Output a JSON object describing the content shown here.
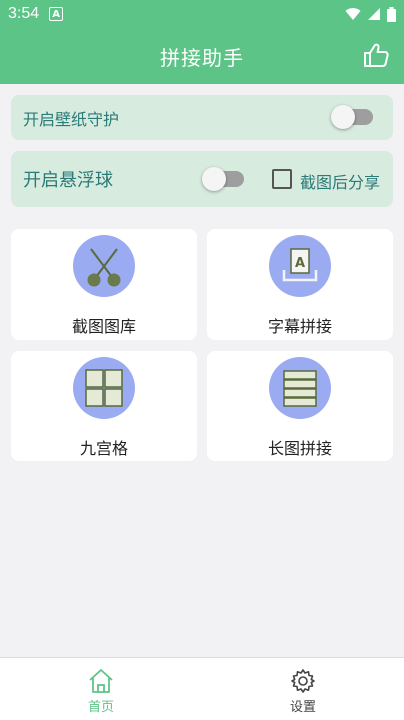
{
  "status_bar": {
    "time": "3:54",
    "notif_letter": "A"
  },
  "app_bar": {
    "title": "拼接助手"
  },
  "settings": {
    "wallpaper_guard_label": "开启壁纸守护",
    "floating_ball_label": "开启悬浮球",
    "share_after_screenshot_label": "截图后分享"
  },
  "tiles": [
    {
      "label": "截图图库",
      "icon": "scissors-icon"
    },
    {
      "label": "字幕拼接",
      "icon": "subtitle-stack-icon"
    },
    {
      "label": "九宫格",
      "icon": "grid-icon"
    },
    {
      "label": "长图拼接",
      "icon": "long-image-icon"
    }
  ],
  "bottom_nav": [
    {
      "label": "首页",
      "icon": "home-icon",
      "active": true
    },
    {
      "label": "设置",
      "icon": "gear-icon",
      "active": false
    }
  ],
  "colors": {
    "primary": "#5cc487",
    "card_bg": "#d7ebde",
    "icon_circle": "#9aabf2",
    "text_accent": "#2a7a78"
  }
}
